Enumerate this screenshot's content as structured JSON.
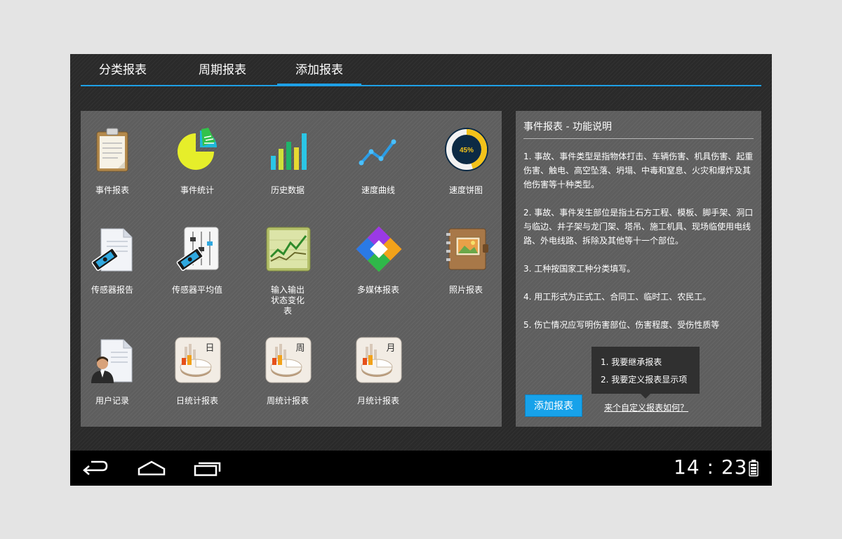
{
  "tabs": [
    {
      "label": "分类报表"
    },
    {
      "label": "周期报表"
    },
    {
      "label": "添加报表",
      "active": true
    }
  ],
  "apps": [
    {
      "label": "事件报表",
      "icon": "clipboard-icon"
    },
    {
      "label": "事件统计",
      "icon": "pie-chart-icon"
    },
    {
      "label": "历史数据",
      "icon": "bar-chart-icon"
    },
    {
      "label": "速度曲线",
      "icon": "line-chart-icon"
    },
    {
      "label": "速度饼图",
      "icon": "donut-chart-icon",
      "badge": "45%"
    },
    {
      "label": "传感器报告",
      "icon": "sensor-report-icon"
    },
    {
      "label": "传感器平均值",
      "icon": "sensor-average-icon"
    },
    {
      "label": "输入输出状态变化表",
      "icon": "io-status-chart-icon"
    },
    {
      "label": "多媒体报表",
      "icon": "multimedia-icon"
    },
    {
      "label": "照片报表",
      "icon": "photo-album-icon"
    },
    {
      "label": "用户记录",
      "icon": "user-record-icon"
    },
    {
      "label": "日统计报表",
      "icon": "daily-stats-icon",
      "badge": "日"
    },
    {
      "label": "周统计报表",
      "icon": "weekly-stats-icon",
      "badge": "周"
    },
    {
      "label": "月统计报表",
      "icon": "monthly-stats-icon",
      "badge": "月"
    }
  ],
  "description": {
    "title": "事件报表 - 功能说明",
    "paragraphs": [
      "1. 事故、事件类型是指物体打击、车辆伤害、机具伤害、起重伤害、触电、高空坠落、坍塌、中毒和窒息、火灾和爆炸及其他伤害等十种类型。",
      "2. 事故、事件发生部位是指土石方工程、模板、脚手架、洞口与临边、井子架与龙门架、塔吊、施工机具、现场临使用电线路、外电线路、拆除及其他等十一个部位。",
      "3. 工种按国家工种分类填写。",
      "4. 用工形式为正式工、合同工、临时工、农民工。",
      "5. 伤亡情况应写明伤害部位、伤害程度、受伤性质等"
    ]
  },
  "popup": {
    "items": [
      "1. 我要继承报表",
      "2. 我要定义报表显示项"
    ]
  },
  "add_button": "添加报表",
  "help_link": "来个自定义报表如何？",
  "status": {
    "time": "14 : 23"
  },
  "colors": {
    "accent": "#1ea0e6",
    "button": "#17a2ea"
  }
}
